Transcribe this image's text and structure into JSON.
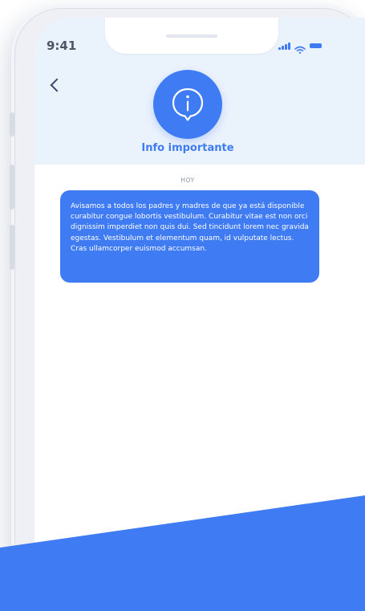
{
  "status_bar": {
    "time": "9:41"
  },
  "header": {
    "title": "Info importante",
    "back_icon": "chevron-left-icon",
    "avatar_icon": "info-icon"
  },
  "conversation": {
    "day_label": "HOY",
    "messages": [
      {
        "text": "Avisamos a todos los padres y madres de que ya está disponible curabitur congue lobortis vestibulum. Curabitur vitae est non orci dignissim imperdiet non quis dui. Sed tincidunt lorem nec gravida egestas. Vestibulum et elementum quam, id vulputate lectus. Cras ullamcorper euismod accumsan."
      }
    ]
  },
  "colors": {
    "accent": "#3f7bf2",
    "header_bg": "#eaf2fc",
    "text_dark": "#4c5668"
  }
}
